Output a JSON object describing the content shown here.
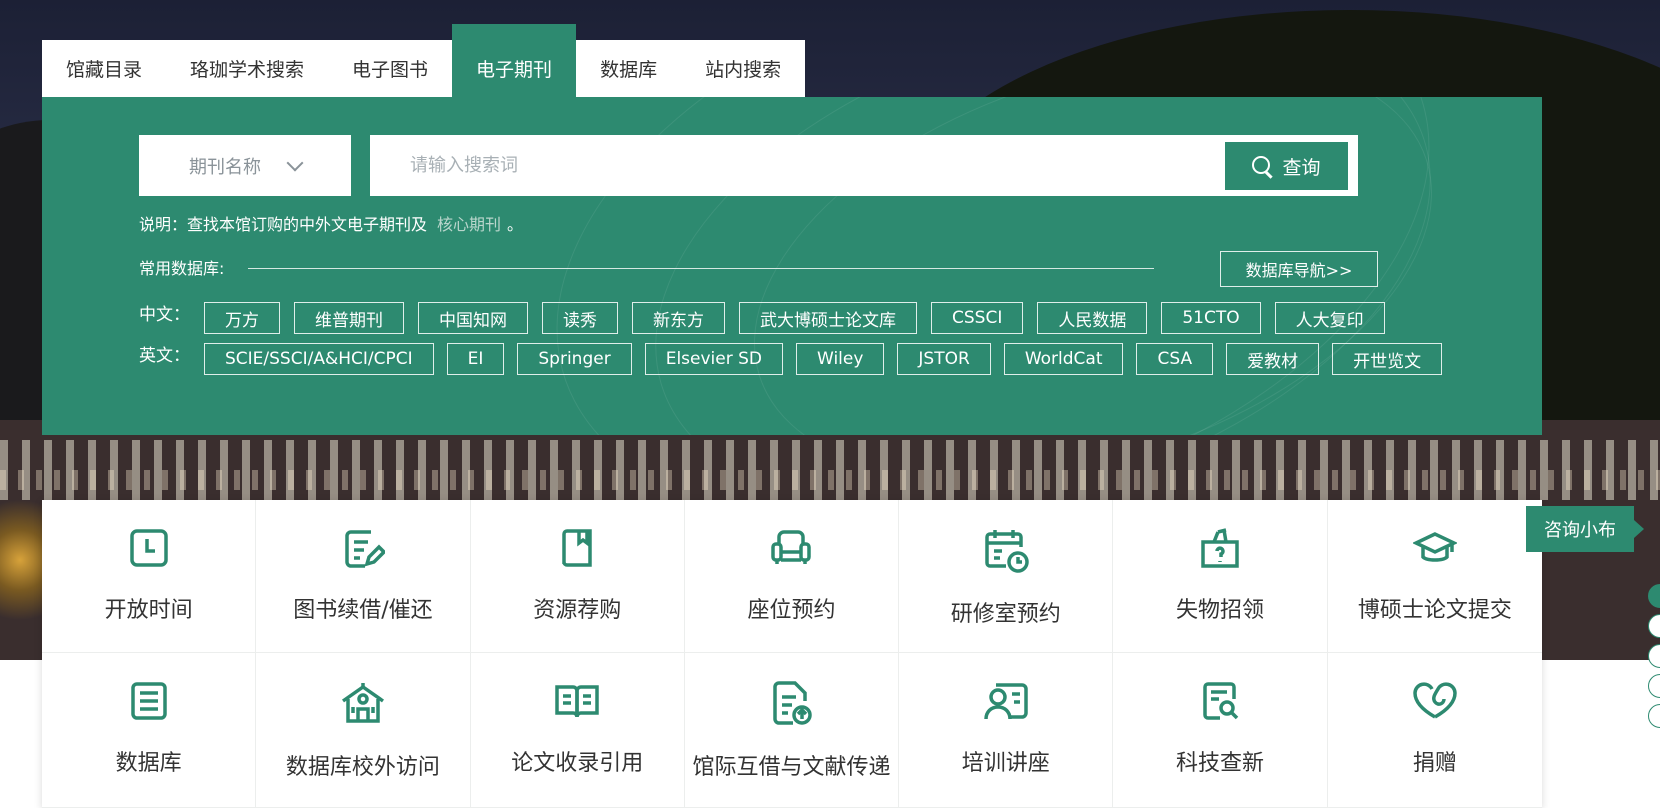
{
  "tabs": [
    {
      "label": "馆藏目录",
      "active": false
    },
    {
      "label": "珞珈学术搜索",
      "active": false
    },
    {
      "label": "电子图书",
      "active": false
    },
    {
      "label": "电子期刊",
      "active": true
    },
    {
      "label": "数据库",
      "active": false
    },
    {
      "label": "站内搜索",
      "active": false
    }
  ],
  "search": {
    "select_value": "期刊名称",
    "placeholder": "请输入搜索词",
    "button_label": "查询"
  },
  "note": {
    "prefix": "说明：查找本馆订购的中外文电子期刊及",
    "link": "核心期刊",
    "suffix": "。"
  },
  "common_db": {
    "label": "常用数据库:",
    "nav_button": "数据库导航>>"
  },
  "chinese_row": {
    "label": "中文：",
    "items": [
      "万方",
      "维普期刊",
      "中国知网",
      "读秀",
      "新东方",
      "武大博硕士论文库",
      "CSSCI",
      "人民数据",
      "51CTO",
      "人大复印"
    ]
  },
  "english_row": {
    "label": "英文：",
    "items": [
      "SCIE/SSCI/A&HCI/CPCI",
      "EI",
      "Springer",
      "Elsevier SD",
      "Wiley",
      "JSTOR",
      "WorldCat",
      "CSA",
      "爱教材",
      "开世览文"
    ]
  },
  "services": [
    {
      "label": "开放时间",
      "icon": "clock-icon"
    },
    {
      "label": "图书续借/催还",
      "icon": "renew-edit-icon"
    },
    {
      "label": "资源荐购",
      "icon": "book-icon"
    },
    {
      "label": "座位预约",
      "icon": "seat-icon"
    },
    {
      "label": "研修室预约",
      "icon": "calendar-clock-icon"
    },
    {
      "label": "失物招领",
      "icon": "lost-found-box-icon"
    },
    {
      "label": "博硕士论文提交",
      "icon": "graduation-cap-icon"
    },
    {
      "label": "数据库",
      "icon": "database-doc-icon"
    },
    {
      "label": "数据库校外访问",
      "icon": "building-icon"
    },
    {
      "label": "论文收录引用",
      "icon": "open-book-icon"
    },
    {
      "label": "馆际互借与文献传递",
      "icon": "document-upload-icon"
    },
    {
      "label": "培训讲座",
      "icon": "lecturer-icon"
    },
    {
      "label": "科技查新",
      "icon": "search-document-icon"
    },
    {
      "label": "捐赠",
      "icon": "heart-icon"
    }
  ],
  "consult": {
    "label": "咨询小布"
  },
  "colors": {
    "brand": "#2d8a70",
    "text": "#333333"
  }
}
